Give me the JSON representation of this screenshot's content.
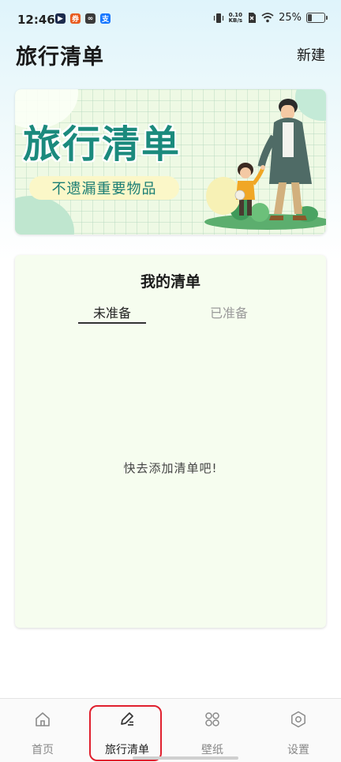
{
  "status_bar": {
    "time": "12:46",
    "net_speed_value": "0.10",
    "net_speed_unit": "KB/s",
    "battery": "25%",
    "battery_level": 0.25,
    "app_icons": [
      "video-app-icon",
      "coupon-app-icon",
      "link-app-icon",
      "alipay-icon"
    ]
  },
  "header": {
    "title": "旅行清单",
    "new_label": "新建"
  },
  "banner": {
    "title": "旅行清单",
    "subtitle": "不遗漏重要物品"
  },
  "my_list": {
    "title": "我的清单",
    "tabs": [
      {
        "label": "未准备",
        "active": true
      },
      {
        "label": "已准备",
        "active": false
      }
    ],
    "empty_text": "快去添加清单吧!"
  },
  "bottom_nav": {
    "items": [
      {
        "label": "首页",
        "icon": "home-icon",
        "active": false
      },
      {
        "label": "旅行清单",
        "icon": "edit-pen-icon",
        "active": true
      },
      {
        "label": "壁纸",
        "icon": "grid-icon",
        "active": false
      },
      {
        "label": "设置",
        "icon": "settings-icon",
        "active": false
      }
    ]
  },
  "colors": {
    "brand_teal": "#1b8a7d",
    "highlight_red": "#e0202e",
    "card_bg": "#f6fdef"
  }
}
